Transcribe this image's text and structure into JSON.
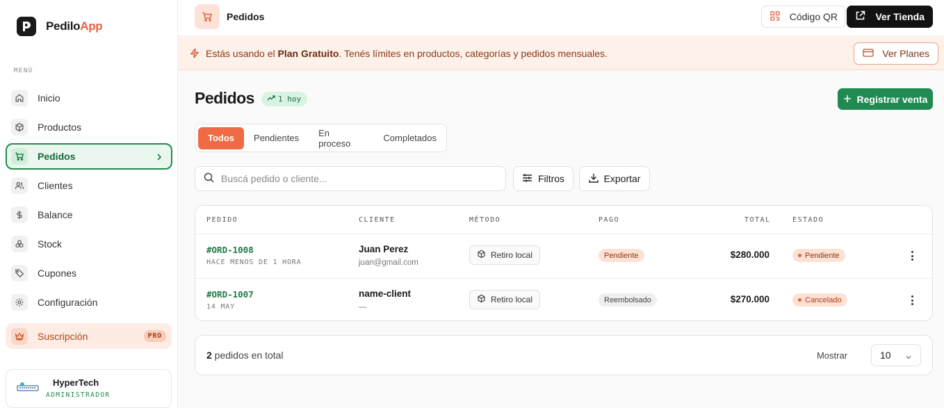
{
  "brand": {
    "name_a": "Pedilo",
    "name_b": "App"
  },
  "sidebar": {
    "menu_label": "MENÚ",
    "items": [
      {
        "label": "Inicio",
        "icon": "home-icon"
      },
      {
        "label": "Productos",
        "icon": "box-icon"
      },
      {
        "label": "Pedidos",
        "icon": "cart-icon",
        "active": true
      },
      {
        "label": "Clientes",
        "icon": "users-icon"
      },
      {
        "label": "Balance",
        "icon": "dollar-icon"
      },
      {
        "label": "Stock",
        "icon": "layers-icon"
      },
      {
        "label": "Cupones",
        "icon": "tag-icon"
      },
      {
        "label": "Configuración",
        "icon": "gear-icon"
      }
    ],
    "subscription": {
      "label": "Suscripción",
      "badge": "PRO",
      "icon": "crown-icon"
    },
    "user": {
      "name": "HyperTech",
      "role": "ADMINISTRADOR"
    }
  },
  "topbar": {
    "title": "Pedidos",
    "qr_label": "Código QR",
    "store_label": "Ver Tienda"
  },
  "banner": {
    "prefix": "Estás usando el ",
    "plan": "Plan Gratuito",
    "suffix": ". Tenés límites en productos, categorías y pedidos mensuales.",
    "button": "Ver Planes"
  },
  "main": {
    "title": "Pedidos",
    "today_badge": "1 hoy",
    "register_button": "Registrar venta",
    "tabs": [
      "Todos",
      "Pendientes",
      "En proceso",
      "Completados"
    ],
    "search_placeholder": "Buscá pedido o cliente...",
    "filter_button": "Filtros",
    "export_button": "Exportar"
  },
  "table": {
    "headers": [
      "PEDIDO",
      "CLIENTE",
      "MÉTODO",
      "PAGO",
      "TOTAL",
      "ESTADO"
    ],
    "rows": [
      {
        "id": "#ORD-1008",
        "time": "HACE MENOS DE 1 HORA",
        "client": "Juan Perez",
        "email": "juan@gmail.com",
        "method": "Retiro local",
        "payment": "Pendiente",
        "total": "$280.000",
        "status": "Pendiente"
      },
      {
        "id": "#ORD-1007",
        "time": "14 MAY",
        "client": "name-client",
        "email": "—",
        "method": "Retiro local",
        "payment": "Reembolsado",
        "total": "$270.000",
        "status": "Cancelado"
      }
    ]
  },
  "footer": {
    "count": "2",
    "count_suffix": " pedidos en total",
    "show_label": "Mostrar",
    "page_size": "10"
  },
  "colors": {
    "accent": "#f06a46",
    "green": "#208a52",
    "dark": "#121212"
  }
}
